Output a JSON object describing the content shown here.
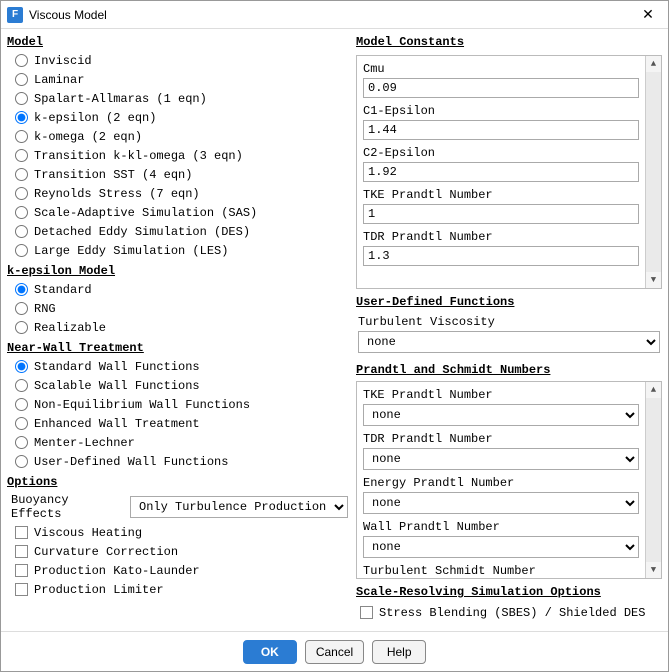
{
  "titlebar": {
    "title": "Viscous Model"
  },
  "model": {
    "title": "Model",
    "items": [
      "Inviscid",
      "Laminar",
      "Spalart-Allmaras (1 eqn)",
      "k-epsilon (2 eqn)",
      "k-omega (2 eqn)",
      "Transition k-kl-omega (3 eqn)",
      "Transition SST (4 eqn)",
      "Reynolds Stress (7 eqn)",
      "Scale-Adaptive Simulation (SAS)",
      "Detached Eddy Simulation (DES)",
      "Large Eddy Simulation (LES)"
    ],
    "selected": 3
  },
  "keModel": {
    "title": "k-epsilon Model",
    "items": [
      "Standard",
      "RNG",
      "Realizable"
    ],
    "selected": 0
  },
  "nearWall": {
    "title": "Near-Wall Treatment",
    "items": [
      "Standard Wall Functions",
      "Scalable Wall Functions",
      "Non-Equilibrium Wall Functions",
      "Enhanced Wall Treatment",
      "Menter-Lechner",
      "User-Defined Wall Functions"
    ],
    "selected": 0
  },
  "options": {
    "title": "Options",
    "buoyancyLabel": "Buoyancy Effects",
    "buoyancyValue": "Only Turbulence Production",
    "checks": [
      "Viscous Heating",
      "Curvature Correction",
      "Production Kato-Launder",
      "Production Limiter"
    ]
  },
  "constants": {
    "title": "Model Constants",
    "items": [
      {
        "label": "Cmu",
        "value": "0.09"
      },
      {
        "label": "C1-Epsilon",
        "value": "1.44"
      },
      {
        "label": "C2-Epsilon",
        "value": "1.92"
      },
      {
        "label": "TKE Prandtl Number",
        "value": "1"
      },
      {
        "label": "TDR Prandtl Number",
        "value": "1.3"
      }
    ]
  },
  "udf": {
    "title": "User-Defined Functions",
    "turbViscLabel": "Turbulent Viscosity",
    "turbViscValue": "none"
  },
  "prSc": {
    "title": "Prandtl and Schmidt Numbers",
    "items": [
      {
        "label": "TKE Prandtl Number",
        "value": "none"
      },
      {
        "label": "TDR Prandtl Number",
        "value": "none"
      },
      {
        "label": "Energy Prandtl Number",
        "value": "none"
      },
      {
        "label": "Wall Prandtl Number",
        "value": "none"
      }
    ],
    "extraLabel": "Turbulent Schmidt Number"
  },
  "srso": {
    "title": "Scale-Resolving Simulation Options",
    "checkLabel": "Stress Blending (SBES) / Shielded DES"
  },
  "footer": {
    "ok": "OK",
    "cancel": "Cancel",
    "help": "Help"
  }
}
